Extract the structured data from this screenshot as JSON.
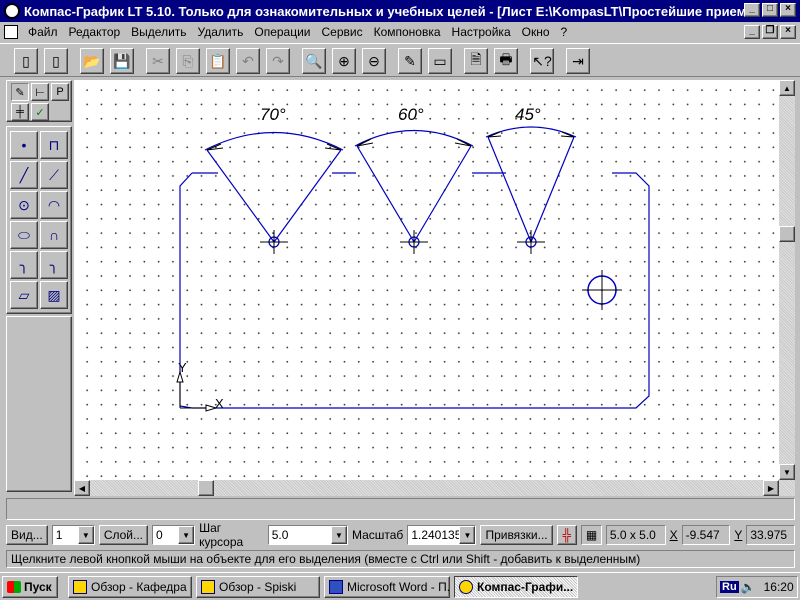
{
  "window": {
    "title": "Компас-График LT 5.10. Только для ознакомительных и учебных целей - [Лист E:\\KompasLT\\Простейшие приемы р..."
  },
  "menu": {
    "items": [
      "Файл",
      "Редактор",
      "Выделить",
      "Удалить",
      "Операции",
      "Сервис",
      "Компоновка",
      "Настройка",
      "Окно",
      "?"
    ]
  },
  "drawing": {
    "angles": [
      "70°",
      "60°",
      "45°"
    ],
    "axis_y": "Y",
    "axis_x": "X"
  },
  "status": {
    "view_button": "Вид...",
    "view_value": "1",
    "layer_button": "Слой...",
    "layer_value": "0",
    "cursor_step_label": "Шаг курсора",
    "cursor_step_value": "5.0",
    "scale_label": "Масштаб",
    "scale_value": "1.240135",
    "snaps_button": "Привязки...",
    "grid_value": "5.0 x 5.0",
    "x_label": "X",
    "x_value": "-9.547",
    "y_label": "Y",
    "y_value": "33.975"
  },
  "hint": "Щелкните левой кнопкой мыши на объекте для его выделения (вместе с Ctrl или Shift - добавить к выделенным)",
  "taskbar": {
    "start": "Пуск",
    "tasks": [
      "Обзор - Кафедра",
      "Обзор - Spiski",
      "Microsoft Word - П...",
      "Компас-Графи..."
    ],
    "lang": "Ru",
    "clock": "16:20"
  },
  "colors": {
    "title_bg": "#000080",
    "drawing_line": "#0000c0",
    "workspace": "#ffffff"
  }
}
